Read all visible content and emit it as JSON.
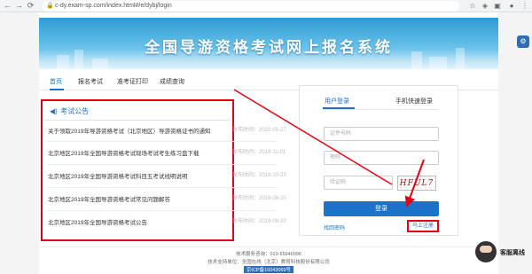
{
  "browser": {
    "url": "c-dy.exam-sp.com/index.html#/e/dybj/login",
    "back_icon": "arrow-left-icon",
    "forward_icon": "arrow-right-icon",
    "reload_icon": "reload-icon"
  },
  "banner": {
    "title": "全国导游资格考试网上报名系统"
  },
  "nav": {
    "items": [
      {
        "label": "首页"
      },
      {
        "label": "报名考试"
      },
      {
        "label": "准考证打印"
      },
      {
        "label": "成绩查询"
      }
    ]
  },
  "notice": {
    "title": "考试公告",
    "items": [
      {
        "text": "关于领取2019年导游资格考试（北京地区）导游资格证书的通知",
        "time": "发布时间：2020-05-27"
      },
      {
        "text": "北京地区2019年全国导游资格考试现场考试考生练习盘下载",
        "time": "发布时间：2019-11-01"
      },
      {
        "text": "北京地区2019年全国导游资格考试科目五考试线明说明",
        "time": "发布时间：2019-10-23"
      },
      {
        "text": "北京地区2019年全国导游资格考试常见问题解答",
        "time": "发布时间：2019-08-20"
      },
      {
        "text": "北京地区2019年全国导游资格考试公告",
        "time": "发布时间：2019-08-20"
      }
    ]
  },
  "login": {
    "tab_user": "用户登录",
    "tab_phone": "手机快速登录",
    "id_placeholder": "证件号码",
    "password_placeholder": "密码",
    "captcha_placeholder": "验证码",
    "captcha_text": "HFUL7",
    "submit_label": "登录",
    "forgot_label": "找回密码",
    "register_label": "马上注册"
  },
  "footer": {
    "line1": "技术服务咨询：010-65946996",
    "line2": "技术支持单位：全国在线（北京）教育科技股份有限公司",
    "icp": "京ICP备16043069号"
  },
  "customer_service": {
    "label": "客服离线"
  },
  "colors": {
    "accent": "#1a73c9",
    "highlight": "#e60012"
  }
}
